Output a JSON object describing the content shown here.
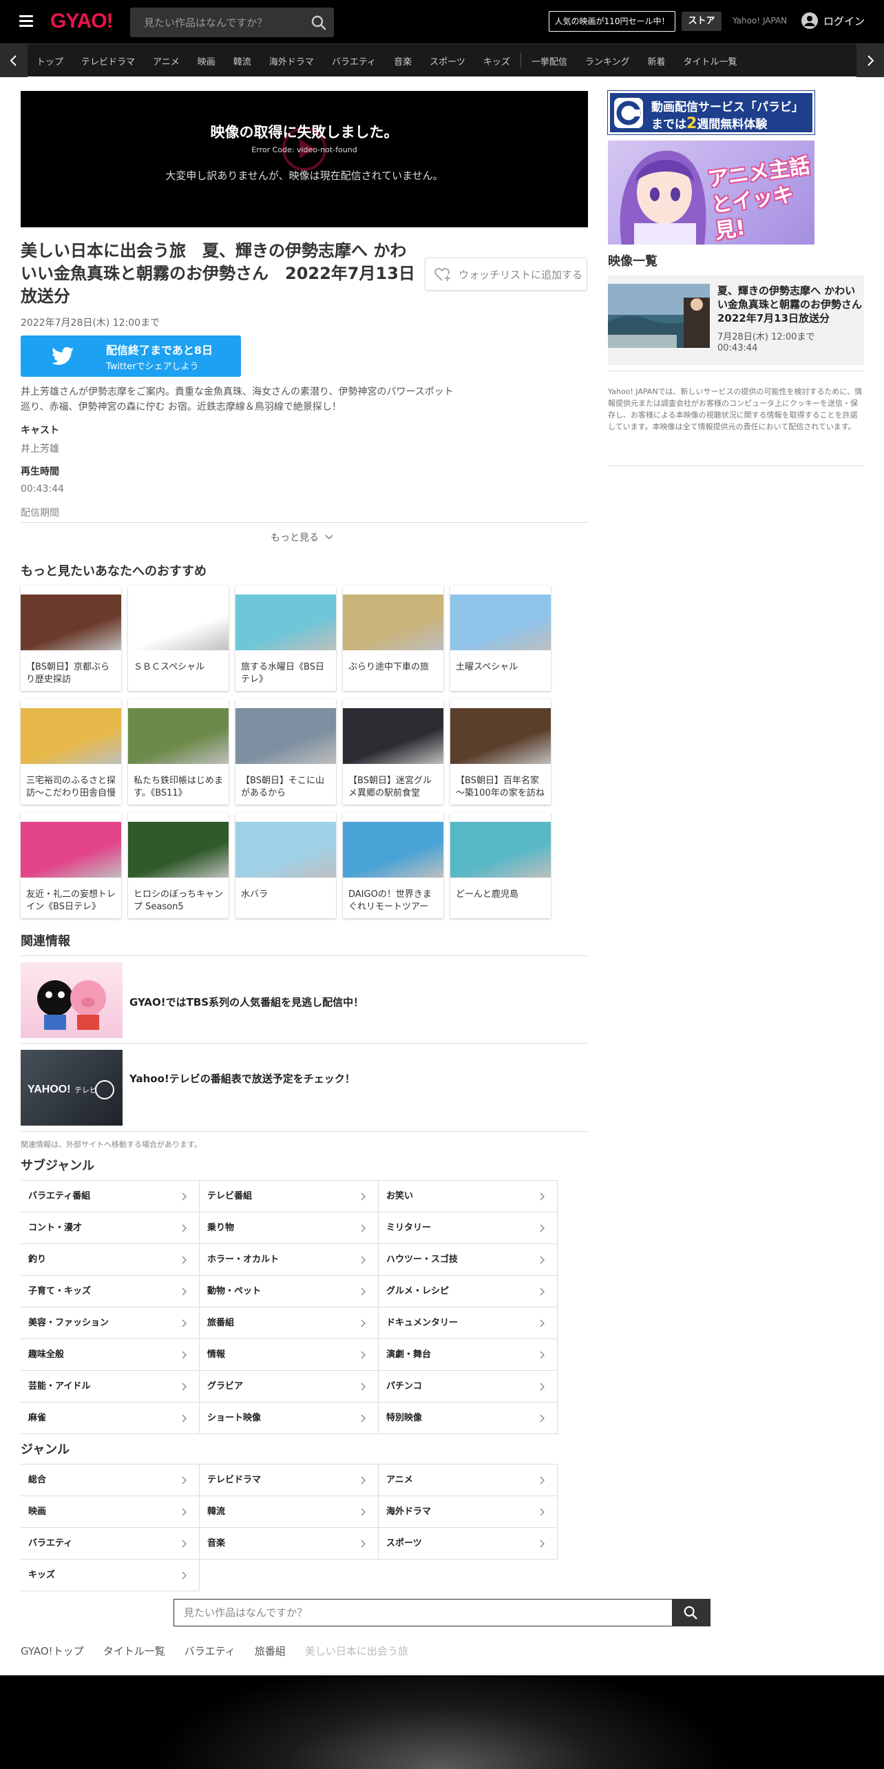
{
  "header": {
    "logo": "GYAO!",
    "search_placeholder": "見たい作品はなんですか？",
    "promo": "人気の映画が110円セール中！",
    "store": "ストア",
    "yahoo": "Yahoo! JAPAN",
    "login": "ログイン"
  },
  "nav": {
    "items": [
      "トップ",
      "テレビドラマ",
      "アニメ",
      "映画",
      "韓流",
      "海外ドラマ",
      "バラエティ",
      "音楽",
      "スポーツ",
      "キッズ",
      "一挙配信",
      "ランキング",
      "新着",
      "タイトル一覧"
    ]
  },
  "player": {
    "error_title": "映像の取得に失敗しました。",
    "error_code": "Error Code: video-not-found",
    "error_message": "大変申し訳ありませんが、映像は現在配信されていません。"
  },
  "program": {
    "title": "美しい日本に出会う旅　夏、輝きの伊勢志摩へ かわいい金魚真珠と朝霧のお伊勢さん　2022年7月13日放送分",
    "watchlist": "ウォッチリストに追加する",
    "until": "2022年7月28日(木) 12:00まで",
    "share_main": "配信終了まであと8日",
    "share_sub": "Twitterでシェアしよう",
    "description": "井上芳雄さんが伊勢志摩をご案内。貴重な金魚真珠、海女さんの素潜り、伊勢神宮のパワースポット巡り、赤福、伊勢神宮の森に佇む お宿。近鉄志摩線＆鳥羽線で絶景探し！",
    "cast_label": "キャスト",
    "cast": "井上芳雄",
    "duration_label": "再生時間",
    "duration": "00:43:44",
    "period_label": "配信期間",
    "more": "もっと見る"
  },
  "recommend": {
    "heading": "もっと見たいあなたへのおすすめ",
    "items": [
      {
        "title": "【BS朝日】京都ぶらり歴史探訪",
        "thumb": "#6b3a2a"
      },
      {
        "title": "ＳＢＣスペシャル",
        "thumb": "#ffffff"
      },
      {
        "title": "旅する水曜日《BS日テレ》",
        "thumb": "#6ec6d8"
      },
      {
        "title": "ぶらり途中下車の旅",
        "thumb": "#c9b37a"
      },
      {
        "title": "土曜スペシャル",
        "thumb": "#8ec3ea"
      },
      {
        "title": "三宅裕司のふるさと探訪～こだわり田舎自慢",
        "thumb": "#e6b94a"
      },
      {
        "title": "私たち鉄印帳はじめます。《BS11》",
        "thumb": "#6d8a4a"
      },
      {
        "title": "【BS朝日】そこに山があるから",
        "thumb": "#7d8fa0"
      },
      {
        "title": "【BS朝日】迷宮グルメ異郷の駅前食堂",
        "thumb": "#2c2c33"
      },
      {
        "title": "【BS朝日】百年名家～築100年の家を訪ね",
        "thumb": "#5b3f2b"
      },
      {
        "title": "友近・礼二の妄想トレイン《BS日テレ》",
        "thumb": "#e2458a"
      },
      {
        "title": "ヒロシのぼっちキャンプ Season5",
        "thumb": "#2f5a2a"
      },
      {
        "title": "水バラ",
        "thumb": "#9ed1e8"
      },
      {
        "title": "DAIGOの！世界きまぐれリモートツアー",
        "thumb": "#4aa3d6"
      },
      {
        "title": "どーんと鹿児島",
        "thumb": "#58b8c6"
      }
    ]
  },
  "related": {
    "heading": "関連情報",
    "items": [
      {
        "text": "GYAO!ではTBS系列の人気番組を見逃し配信中！"
      },
      {
        "text": "Yahoo!テレビの番組表で放送予定をチェック！"
      }
    ],
    "note": "関連情報は、外部サイトへ移動する場合があります。"
  },
  "subgenre": {
    "heading": "サブジャンル",
    "items": [
      "バラエティ番組",
      "テレビ番組",
      "お笑い",
      "コント・漫才",
      "乗り物",
      "ミリタリー",
      "釣り",
      "ホラー・オカルト",
      "ハウツー・スゴ技",
      "子育て・キッズ",
      "動物・ペット",
      "グルメ・レシピ",
      "美容・ファッション",
      "旅番組",
      "ドキュメンタリー",
      "趣味全般",
      "情報",
      "演劇・舞台",
      "芸能・アイドル",
      "グラビア",
      "パチンコ",
      "麻雀",
      "ショート映像",
      "特別映像"
    ]
  },
  "genre": {
    "heading": "ジャンル",
    "items": [
      "総合",
      "テレビドラマ",
      "アニメ",
      "映画",
      "韓流",
      "海外ドラマ",
      "バラエティ",
      "音楽",
      "スポーツ",
      "キッズ"
    ]
  },
  "bottom": {
    "search_placeholder": "見たい作品はなんですか？",
    "breadcrumbs": [
      "GYAO!トップ",
      "タイトル一覧",
      "バラエティ",
      "旅番組",
      "美しい日本に出会う旅"
    ]
  },
  "sidebar": {
    "ad1_line1": "動画配信サービス「パラビ」",
    "ad1_line2_pre": "までは",
    "ad1_line2_num": "2",
    "ad1_line2_post": "週間無料体験",
    "ad2_text": "アニメ主話とイッキ見!",
    "video_heading": "映像一覧",
    "video_title": "夏、輝きの伊勢志摩へ かわいい金魚真珠と朝霧のお伊勢さん　2022年7月13日放送分",
    "video_until": "7月28日(木) 12:00まで",
    "video_length": "00:43:44",
    "notice": "Yahoo! JAPANでは、新しいサービスの提供の可能性を検討するために、情報提供元または調査会社がお客様のコンピュータ上にクッキーを送信・保存し、お客様による本映像の視聴状況に関する情報を取得することを許諾しています。本映像は全て情報提供元の責任において配信されています。"
  },
  "colors": {
    "brand": "#e8154b",
    "twitter": "#1da1f2",
    "paravi": "#1e3f8c"
  }
}
